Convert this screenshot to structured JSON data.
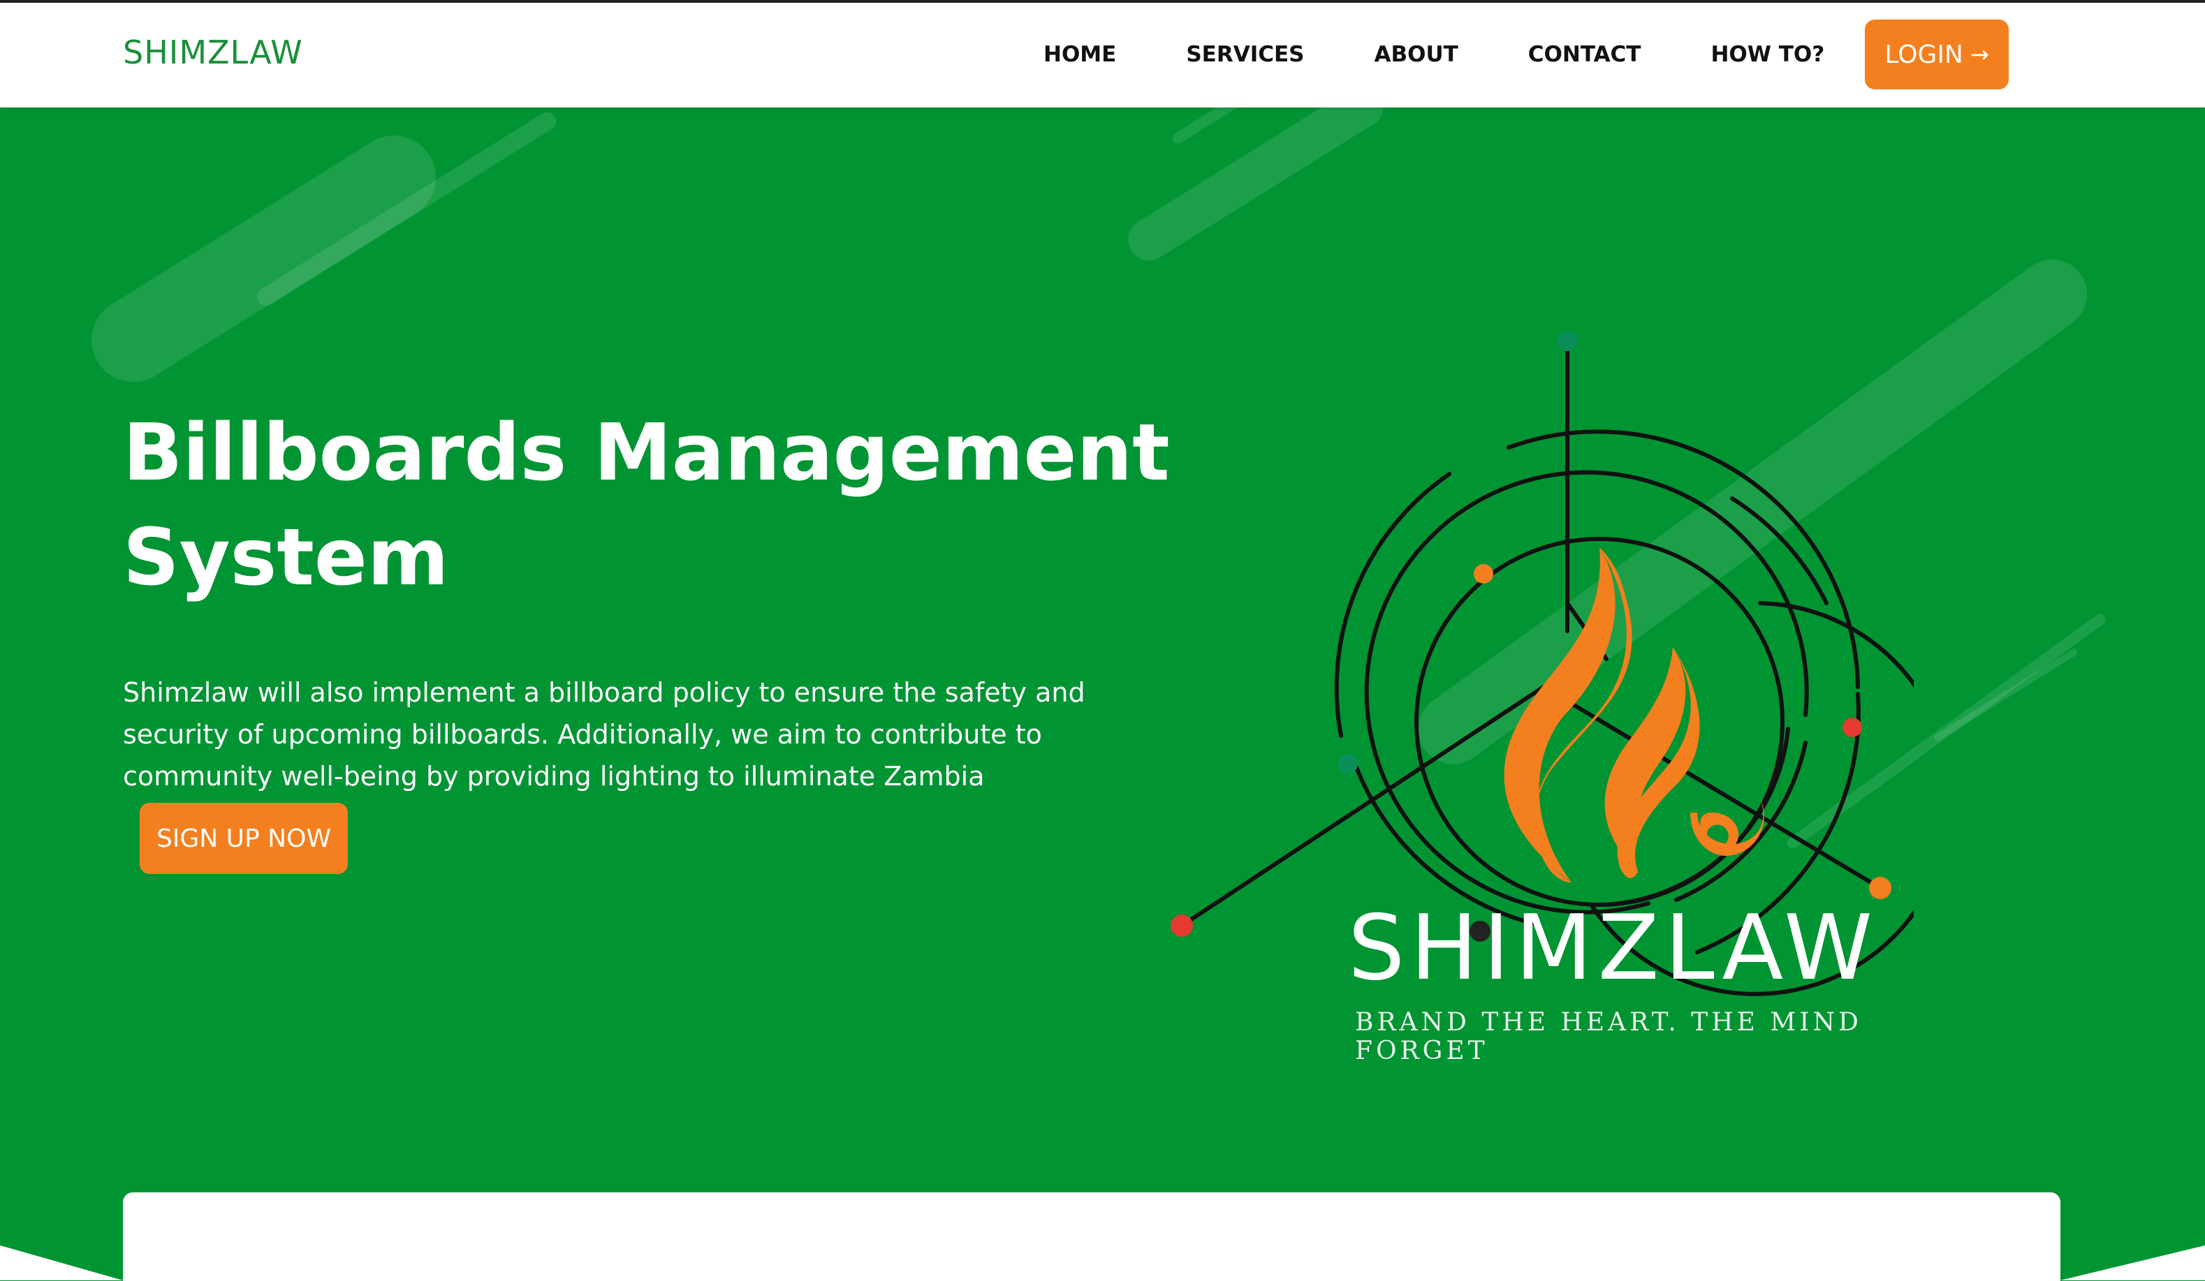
{
  "navbar": {
    "brand": "SHIMZLAW",
    "links": [
      "HOME",
      "SERVICES",
      "ABOUT",
      "CONTACT",
      "HOW TO?"
    ],
    "login_label": "LOGIN",
    "login_arrow": "→"
  },
  "hero": {
    "title": "Billboards Management System",
    "description": "Shimzlaw will also implement a billboard policy to ensure the safety and security of upcoming billboards. Additionally, we aim to contribute to community well-being by providing lighting to illuminate Zambia",
    "signup_label": "SIGN UP NOW",
    "logo_name": "SHIMZLAW",
    "logo_tagline": "Brand The Heart. The Mind Forget"
  },
  "colors": {
    "primary_green": "#009433",
    "brand_green": "#1a8f3a",
    "accent_orange": "#f47f1f",
    "flame_orange": "#f47f1f",
    "dot_red": "#e53a2f",
    "dot_teal": "#0b8f5a"
  },
  "icons": {
    "login_arrow": "arrow-right-icon",
    "logo": "flame-circuit-logo"
  }
}
